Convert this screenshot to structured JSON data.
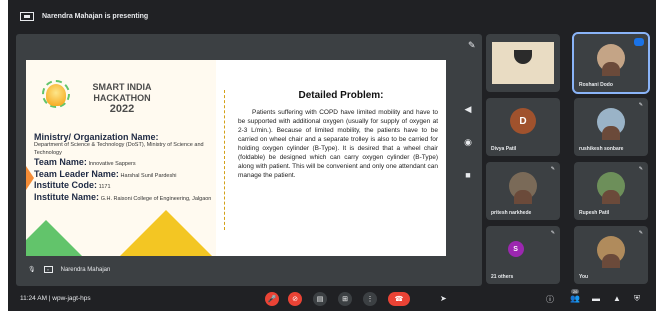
{
  "presenter": {
    "text": "Narendra Mahajan is presenting"
  },
  "slide": {
    "logo": {
      "line1": "SMART INDIA",
      "line2": "HACKATHON",
      "year": "2022"
    },
    "fields": [
      {
        "label": "Ministry/ Organization Name:",
        "value": "Department of Science & Technology (DoST), Ministry of Science and Technology"
      },
      {
        "label": "Team Name:",
        "value": "Innovative Sappers"
      },
      {
        "label": "Team Leader Name:",
        "value": "Harshal Sunil Pardeshi"
      },
      {
        "label": "Institute Code:",
        "value": "1171"
      },
      {
        "label": "Institute Name:",
        "value": "G.H. Raisoni College of Engineering, Jalgaon"
      }
    ],
    "problem_title": "Detailed Problem:",
    "problem_text": "Patients suffering with COPD have limited mobility and have to be supported with additional oxygen (usually for supply of oxygen at 2-3 L/min.). Because of limited mobility, the patients have to be carried on wheel chair and a separate trolley is also to be carried for holding oxygen cylinder (B-Type). It is desired that a wheel chair (foldable) be designed which can carry oxygen cylinder (B-Type) along with patient. This will be convenient and only one attendant can manage the patient."
  },
  "stage_footer": {
    "name": "Narendra Mahajan"
  },
  "participants": [
    {
      "name": "",
      "kind": "screen"
    },
    {
      "name": "Roshani Dodo",
      "kind": "photo"
    },
    {
      "name": "Divya Patil",
      "kind": "initial",
      "initial": "D",
      "color": "#a0522d"
    },
    {
      "name": "rushikesh sonbare",
      "kind": "photo"
    },
    {
      "name": "pritesh narkhede",
      "kind": "photo"
    },
    {
      "name": "Rupesh Patil",
      "kind": "photo"
    },
    {
      "name": "21 others",
      "kind": "others",
      "initial": "S",
      "color": "#9c27b0"
    },
    {
      "name": "You",
      "kind": "photo"
    }
  ],
  "toolbar": {
    "time": "11:24 AM",
    "meeting_code": "wpw-jagt-hps",
    "people_count": "26"
  },
  "colors": {
    "background": "#202124",
    "tile": "#3c4043",
    "red": "#ea4335",
    "accent": "#1a73e8"
  }
}
